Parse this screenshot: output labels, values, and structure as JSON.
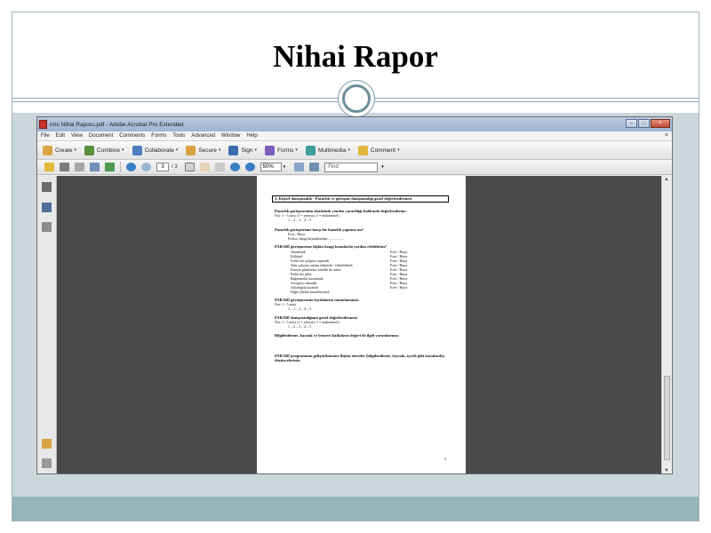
{
  "slide": {
    "title": "Nihai Rapor"
  },
  "app": {
    "title": "rmc Nihai Raporu.pdf - Adobe Acrobat Pro Extended",
    "window_buttons": {
      "minimize": "–",
      "maximize": "□",
      "close": "×"
    }
  },
  "menu": {
    "items": [
      "File",
      "Edit",
      "View",
      "Document",
      "Comments",
      "Forms",
      "Tools",
      "Advanced",
      "Window",
      "Help"
    ],
    "close_glyph": "×"
  },
  "toolbar": {
    "tasks": [
      {
        "label": "Create",
        "icon": "create-pdf-icon",
        "color": "#d9a441"
      },
      {
        "label": "Combine",
        "icon": "combine-files-icon",
        "color": "#5a8f3c"
      },
      {
        "label": "Collaborate",
        "icon": "collaborate-icon",
        "color": "#4f7fbf"
      },
      {
        "label": "Secure",
        "icon": "lock-icon",
        "color": "#d9a441"
      },
      {
        "label": "Sign",
        "icon": "pen-sign-icon",
        "color": "#3d6fb0"
      },
      {
        "label": "Forms",
        "icon": "forms-icon",
        "color": "#7a5fbf"
      },
      {
        "label": "Multimedia",
        "icon": "multimedia-icon",
        "color": "#3d9f9a"
      },
      {
        "label": "Comment",
        "icon": "comment-icon",
        "color": "#e2b73c"
      }
    ],
    "caret": "▾"
  },
  "toolbar2": {
    "page_current": "3",
    "page_total": "/ 3",
    "zoom": "50%",
    "find_placeholder": "Find"
  },
  "page": {
    "header": "3. Kişisel danışmanlık - Pazarlık ve görüşme danışmanlığı genel değerlendirmesi",
    "questions": [
      {
        "q": "Pazarlık görüşmesinin akademik yönden yararlılığı hakkında değerlendirme:",
        "lines": [
          "Not: 1 - 5 arası (1 = yetersiz, 5 = mükemmel)",
          "1 – 2 – 3 – 4 – 5"
        ]
      },
      {
        "q": "Pazarlık görüşmesine karşı bir hazırlık yaptınız mı?",
        "lines": [
          "Evet / Hayır",
          "Evetse, hangi kaynaklardan: ................"
        ]
      },
      {
        "q": "PARABİ görüşmesine ilişkin hangi konularda yardım edebilirim?",
        "lines": []
      },
      {
        "q": "PARABİ görüşmesinin faydalarını tanımlamanız:",
        "lines": [
          "Not: 1 - 5 arası",
          "1 – 2 – 3 – 4 – 5"
        ]
      },
      {
        "q": "PARABİ danışmanlığının genel değerlendirmesi:",
        "lines": [
          "Not: 1 - 5 arası (1 = yetersiz, 5 = mükemmel)",
          "1 – 2 – 3 – 4 – 5"
        ]
      },
      {
        "q": "Bilgilendirme, kaynak ve benzeri katkıların değeri ile ilgili yorumlarınız:",
        "lines": []
      },
      {
        "q": "PARABİ programının geliştirilmesine ilişkin öneriler (bilgilendirme, kaynak, içerik gibi konularda) düşünceleriniz:",
        "lines": []
      }
    ],
    "rows": [
      {
        "label": "Akademik",
        "value": "Evet / Hayır"
      },
      {
        "label": "Kültürel",
        "value": "Evet / Hayır"
      },
      {
        "label": "Farklı bir çalışma yaşamak",
        "value": "Evet / Hayır"
      },
      {
        "label": "Yeni çalışma ortamı edinmek / edinebilmek",
        "value": "Evet / Hayır"
      },
      {
        "label": "Kariyer planlarına yönelik bir adım",
        "value": "Evet / Hayır"
      },
      {
        "label": "Farklı bir şehir",
        "value": "Evet / Hayır"
      },
      {
        "label": "Bağımsızlık kazanmak",
        "value": "Evet / Hayır"
      },
      {
        "label": "Avrupa'yı tanımak",
        "value": "Evet / Hayır"
      },
      {
        "label": "Arkadaşlık kurmak",
        "value": "Evet / Hayır"
      },
      {
        "label": "Diğer (lütfen tanımlayınız):",
        "value": ""
      }
    ],
    "page_number": "3"
  },
  "colors": {
    "band": "#ccd7dc",
    "footer": "#95b4bc",
    "doc_background": "#4a4a4a"
  }
}
